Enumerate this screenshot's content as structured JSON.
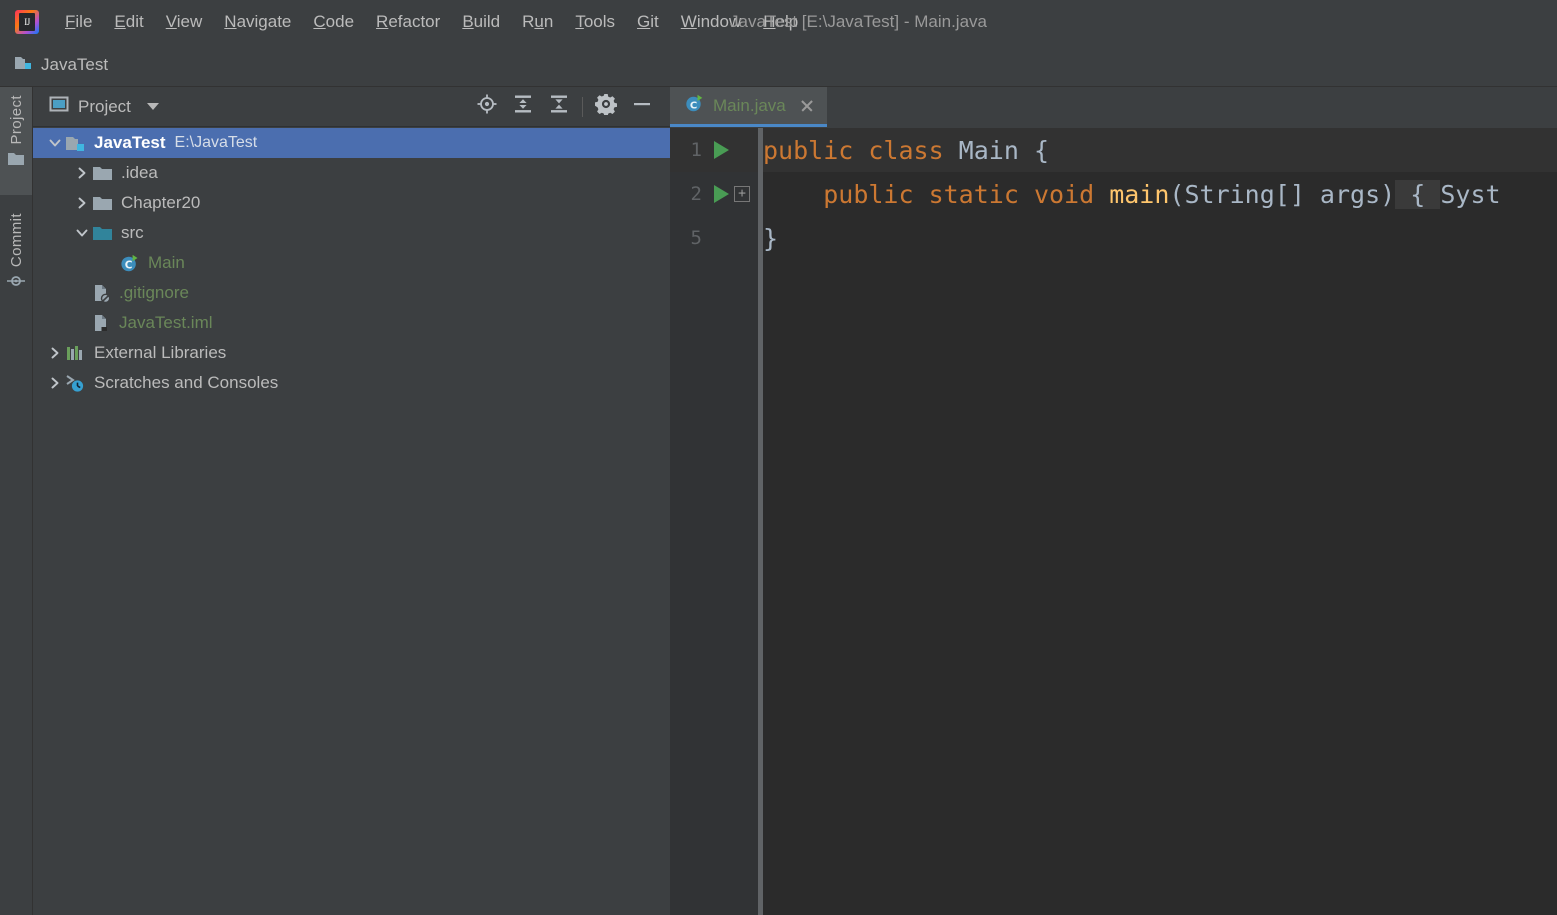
{
  "window": {
    "title": "JavaTest [E:\\JavaTest] - Main.java",
    "app_logo": "intellij-idea-logo"
  },
  "menubar": {
    "items": [
      {
        "label": "File",
        "mnemonic_index": 0
      },
      {
        "label": "Edit",
        "mnemonic_index": 0
      },
      {
        "label": "View",
        "mnemonic_index": 0
      },
      {
        "label": "Navigate",
        "mnemonic_index": 0
      },
      {
        "label": "Code",
        "mnemonic_index": 0
      },
      {
        "label": "Refactor",
        "mnemonic_index": 0
      },
      {
        "label": "Build",
        "mnemonic_index": 0
      },
      {
        "label": "Run",
        "mnemonic_index": 1
      },
      {
        "label": "Tools",
        "mnemonic_index": 0
      },
      {
        "label": "Git",
        "mnemonic_index": 0
      },
      {
        "label": "Window",
        "mnemonic_index": 0
      },
      {
        "label": "Help",
        "mnemonic_index": 0
      }
    ]
  },
  "navbar": {
    "crumb_label": "JavaTest",
    "crumb_icon": "module-folder-icon"
  },
  "stripe": {
    "buttons": [
      {
        "label": "Project",
        "icon": "folder-icon",
        "active": true
      },
      {
        "label": "Commit",
        "icon": "commit-node-icon",
        "active": false
      }
    ]
  },
  "project_panel": {
    "title": "Project",
    "title_icon": "project-view-icon",
    "dropdown_icon": "chevron-down-icon",
    "toolbar_actions": [
      {
        "name": "select-opened-file",
        "icon": "crosshair-target-icon",
        "tooltip": "Select Opened File"
      },
      {
        "name": "expand-all",
        "icon": "expand-all-icon",
        "tooltip": "Expand All"
      },
      {
        "name": "collapse-all",
        "icon": "collapse-all-icon",
        "tooltip": "Collapse All"
      },
      {
        "name": "settings",
        "icon": "gear-icon",
        "tooltip": "Settings"
      },
      {
        "name": "hide",
        "icon": "minus-icon",
        "tooltip": "Hide"
      }
    ],
    "tree": [
      {
        "label": "JavaTest",
        "sublabel": "E:\\JavaTest",
        "indent": 0,
        "arrow": "expanded",
        "icon": "module-folder-icon",
        "color": "white-bold",
        "selected": true
      },
      {
        "label": ".idea",
        "indent": 1,
        "arrow": "collapsed",
        "icon": "folder-icon",
        "color": "grey",
        "selected": false
      },
      {
        "label": "Chapter20",
        "indent": 1,
        "arrow": "collapsed",
        "icon": "folder-icon",
        "color": "grey",
        "selected": false
      },
      {
        "label": "src",
        "indent": 1,
        "arrow": "expanded",
        "icon": "source-folder-icon",
        "color": "grey",
        "selected": false
      },
      {
        "label": "Main",
        "indent": 2,
        "arrow": "none",
        "icon": "java-class-run-icon",
        "color": "green",
        "selected": false
      },
      {
        "label": ".gitignore",
        "indent": 1,
        "arrow": "none",
        "icon": "gitignore-file-icon",
        "color": "green",
        "selected": false
      },
      {
        "label": "JavaTest.iml",
        "indent": 1,
        "arrow": "none",
        "icon": "iml-file-icon",
        "color": "green",
        "selected": false
      },
      {
        "label": "External Libraries",
        "indent": 0,
        "arrow": "collapsed",
        "icon": "libraries-icon",
        "color": "grey",
        "selected": false
      },
      {
        "label": "Scratches and Consoles",
        "indent": 0,
        "arrow": "collapsed",
        "icon": "scratches-icon",
        "color": "grey",
        "selected": false
      }
    ]
  },
  "editor": {
    "tabs": [
      {
        "label": "Main.java",
        "icon": "java-class-run-icon",
        "active": true,
        "close_icon": "close-icon"
      }
    ],
    "gutter_lines": [
      {
        "number": "1",
        "run_marker": true,
        "fold_marker": false,
        "current": true
      },
      {
        "number": "2",
        "run_marker": true,
        "fold_marker": true,
        "current": false
      },
      {
        "number": "5",
        "run_marker": false,
        "fold_marker": false,
        "current": false
      }
    ],
    "fold_marker_glyph": "+",
    "code_lines": [
      {
        "current": true,
        "tokens": [
          {
            "text": "public ",
            "style": "k"
          },
          {
            "text": "class ",
            "style": "k"
          },
          {
            "text": "Main",
            "style": "cn"
          },
          {
            "text": " {",
            "style": "t"
          }
        ]
      },
      {
        "current": false,
        "tokens": [
          {
            "text": "    ",
            "style": "t"
          },
          {
            "text": "public ",
            "style": "k"
          },
          {
            "text": "static ",
            "style": "k"
          },
          {
            "text": "void ",
            "style": "k"
          },
          {
            "text": "main",
            "style": "mn"
          },
          {
            "text": "(String[] args)",
            "style": "t"
          },
          {
            "text": " { ",
            "style": "fold"
          },
          {
            "text": "Syst",
            "style": "t"
          }
        ]
      },
      {
        "current": false,
        "tokens": [
          {
            "text": "}",
            "style": "t"
          }
        ]
      }
    ]
  },
  "colors": {
    "panel_bg": "#3c3f41",
    "editor_bg": "#2b2b2b",
    "gutter_bg": "#313335",
    "selection_blue": "#4b6eaf",
    "tab_underline": "#4a88c7",
    "keyword_orange": "#cc7832",
    "text_blue_grey": "#a9b7c6",
    "method_yellow": "#ffc66d",
    "file_green": "#6a8759",
    "run_green": "#499c54"
  }
}
